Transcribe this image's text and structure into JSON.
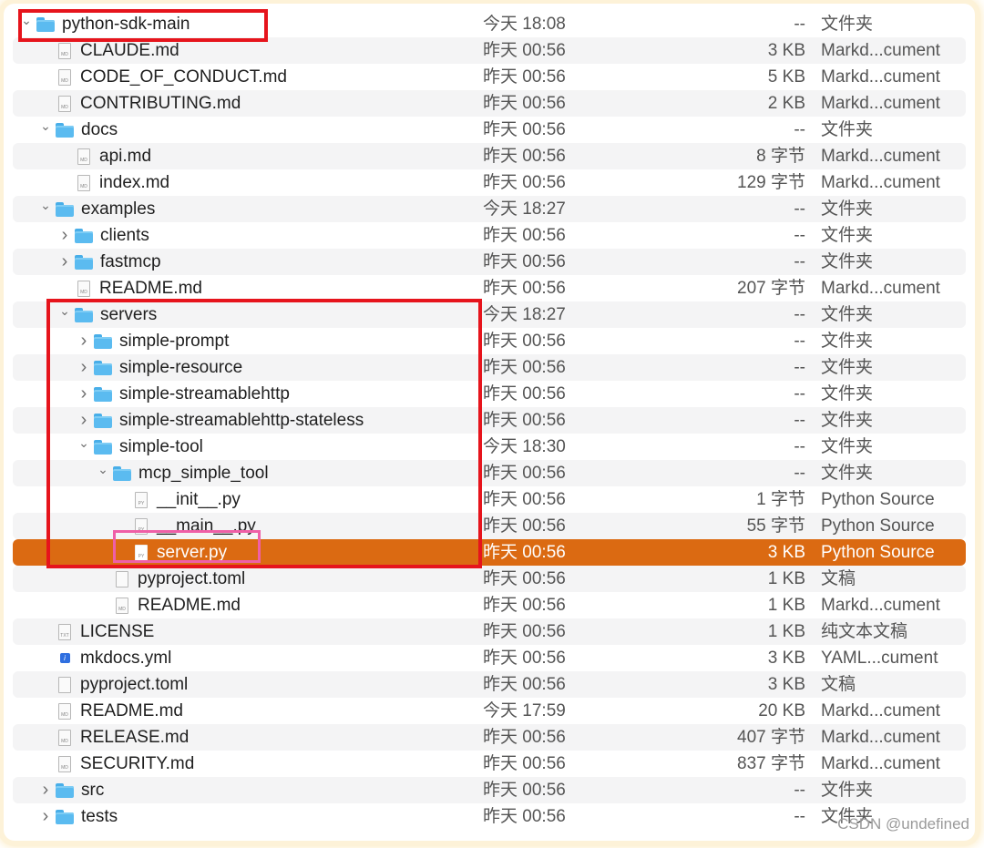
{
  "rows": [
    {
      "name": "python-sdk-main",
      "level": 0,
      "type": "folder",
      "chevron": "down",
      "date": "今天 18:08",
      "size": "--",
      "kind": "文件夹"
    },
    {
      "name": "CLAUDE.md",
      "level": 1,
      "type": "doc",
      "tag": "MD",
      "date": "昨天 00:56",
      "size": "3 KB",
      "kind": "Markd...cument"
    },
    {
      "name": "CODE_OF_CONDUCT.md",
      "level": 1,
      "type": "doc",
      "tag": "MD",
      "date": "昨天 00:56",
      "size": "5 KB",
      "kind": "Markd...cument"
    },
    {
      "name": "CONTRIBUTING.md",
      "level": 1,
      "type": "doc",
      "tag": "MD",
      "date": "昨天 00:56",
      "size": "2 KB",
      "kind": "Markd...cument"
    },
    {
      "name": "docs",
      "level": 1,
      "type": "folder",
      "chevron": "down",
      "date": "昨天 00:56",
      "size": "--",
      "kind": "文件夹"
    },
    {
      "name": "api.md",
      "level": 2,
      "type": "doc",
      "tag": "MD",
      "date": "昨天 00:56",
      "size": "8 字节",
      "kind": "Markd...cument"
    },
    {
      "name": "index.md",
      "level": 2,
      "type": "doc",
      "tag": "MD",
      "date": "昨天 00:56",
      "size": "129 字节",
      "kind": "Markd...cument"
    },
    {
      "name": "examples",
      "level": 1,
      "type": "folder",
      "chevron": "down",
      "date": "今天 18:27",
      "size": "--",
      "kind": "文件夹"
    },
    {
      "name": "clients",
      "level": 2,
      "type": "folder",
      "chevron": "right",
      "date": "昨天 00:56",
      "size": "--",
      "kind": "文件夹"
    },
    {
      "name": "fastmcp",
      "level": 2,
      "type": "folder",
      "chevron": "right",
      "date": "昨天 00:56",
      "size": "--",
      "kind": "文件夹"
    },
    {
      "name": "README.md",
      "level": 2,
      "type": "doc",
      "tag": "MD",
      "date": "昨天 00:56",
      "size": "207 字节",
      "kind": "Markd...cument"
    },
    {
      "name": "servers",
      "level": 2,
      "type": "folder",
      "chevron": "down",
      "date": "今天 18:27",
      "size": "--",
      "kind": "文件夹"
    },
    {
      "name": "simple-prompt",
      "level": 3,
      "type": "folder",
      "chevron": "right",
      "date": "昨天 00:56",
      "size": "--",
      "kind": "文件夹"
    },
    {
      "name": "simple-resource",
      "level": 3,
      "type": "folder",
      "chevron": "right",
      "date": "昨天 00:56",
      "size": "--",
      "kind": "文件夹"
    },
    {
      "name": "simple-streamablehttp",
      "level": 3,
      "type": "folder",
      "chevron": "right",
      "date": "昨天 00:56",
      "size": "--",
      "kind": "文件夹"
    },
    {
      "name": "simple-streamablehttp-stateless",
      "level": 3,
      "type": "folder",
      "chevron": "right",
      "date": "昨天 00:56",
      "size": "--",
      "kind": "文件夹"
    },
    {
      "name": "simple-tool",
      "level": 3,
      "type": "folder",
      "chevron": "down",
      "date": "今天 18:30",
      "size": "--",
      "kind": "文件夹"
    },
    {
      "name": "mcp_simple_tool",
      "level": 4,
      "type": "folder",
      "chevron": "down",
      "date": "昨天 00:56",
      "size": "--",
      "kind": "文件夹"
    },
    {
      "name": "__init__.py",
      "level": 5,
      "type": "doc",
      "tag": "PY",
      "date": "昨天 00:56",
      "size": "1 字节",
      "kind": "Python Source"
    },
    {
      "name": "__main__.py",
      "level": 5,
      "type": "doc",
      "tag": "PY",
      "date": "昨天 00:56",
      "size": "55 字节",
      "kind": "Python Source"
    },
    {
      "name": "server.py",
      "level": 5,
      "type": "doc",
      "tag": "PY",
      "date": "昨天 00:56",
      "size": "3 KB",
      "kind": "Python Source",
      "selected": true
    },
    {
      "name": "pyproject.toml",
      "level": 4,
      "type": "doc",
      "tag": "",
      "date": "昨天 00:56",
      "size": "1 KB",
      "kind": "文稿"
    },
    {
      "name": "README.md",
      "level": 4,
      "type": "doc",
      "tag": "MD",
      "date": "昨天 00:56",
      "size": "1 KB",
      "kind": "Markd...cument"
    },
    {
      "name": "LICENSE",
      "level": 1,
      "type": "doc",
      "tag": "TXT",
      "date": "昨天 00:56",
      "size": "1 KB",
      "kind": "纯文本文稿"
    },
    {
      "name": "mkdocs.yml",
      "level": 1,
      "type": "yaml",
      "date": "昨天 00:56",
      "size": "3 KB",
      "kind": "YAML...cument"
    },
    {
      "name": "pyproject.toml",
      "level": 1,
      "type": "doc",
      "tag": "",
      "date": "昨天 00:56",
      "size": "3 KB",
      "kind": "文稿"
    },
    {
      "name": "README.md",
      "level": 1,
      "type": "doc",
      "tag": "MD",
      "date": "今天 17:59",
      "size": "20 KB",
      "kind": "Markd...cument"
    },
    {
      "name": "RELEASE.md",
      "level": 1,
      "type": "doc",
      "tag": "MD",
      "date": "昨天 00:56",
      "size": "407 字节",
      "kind": "Markd...cument"
    },
    {
      "name": "SECURITY.md",
      "level": 1,
      "type": "doc",
      "tag": "MD",
      "date": "昨天 00:56",
      "size": "837 字节",
      "kind": "Markd...cument"
    },
    {
      "name": "src",
      "level": 1,
      "type": "folder",
      "chevron": "right",
      "date": "昨天 00:56",
      "size": "--",
      "kind": "文件夹"
    },
    {
      "name": "tests",
      "level": 1,
      "type": "folder",
      "chevron": "right",
      "date": "昨天 00:56",
      "size": "--",
      "kind": "文件夹"
    }
  ],
  "colors": {
    "selected": "#db6a12",
    "folder": "#5bbbf0",
    "annotation_red": "#e6141c",
    "annotation_pink": "#ef5fa7"
  },
  "watermark": "CSDN @undefined"
}
